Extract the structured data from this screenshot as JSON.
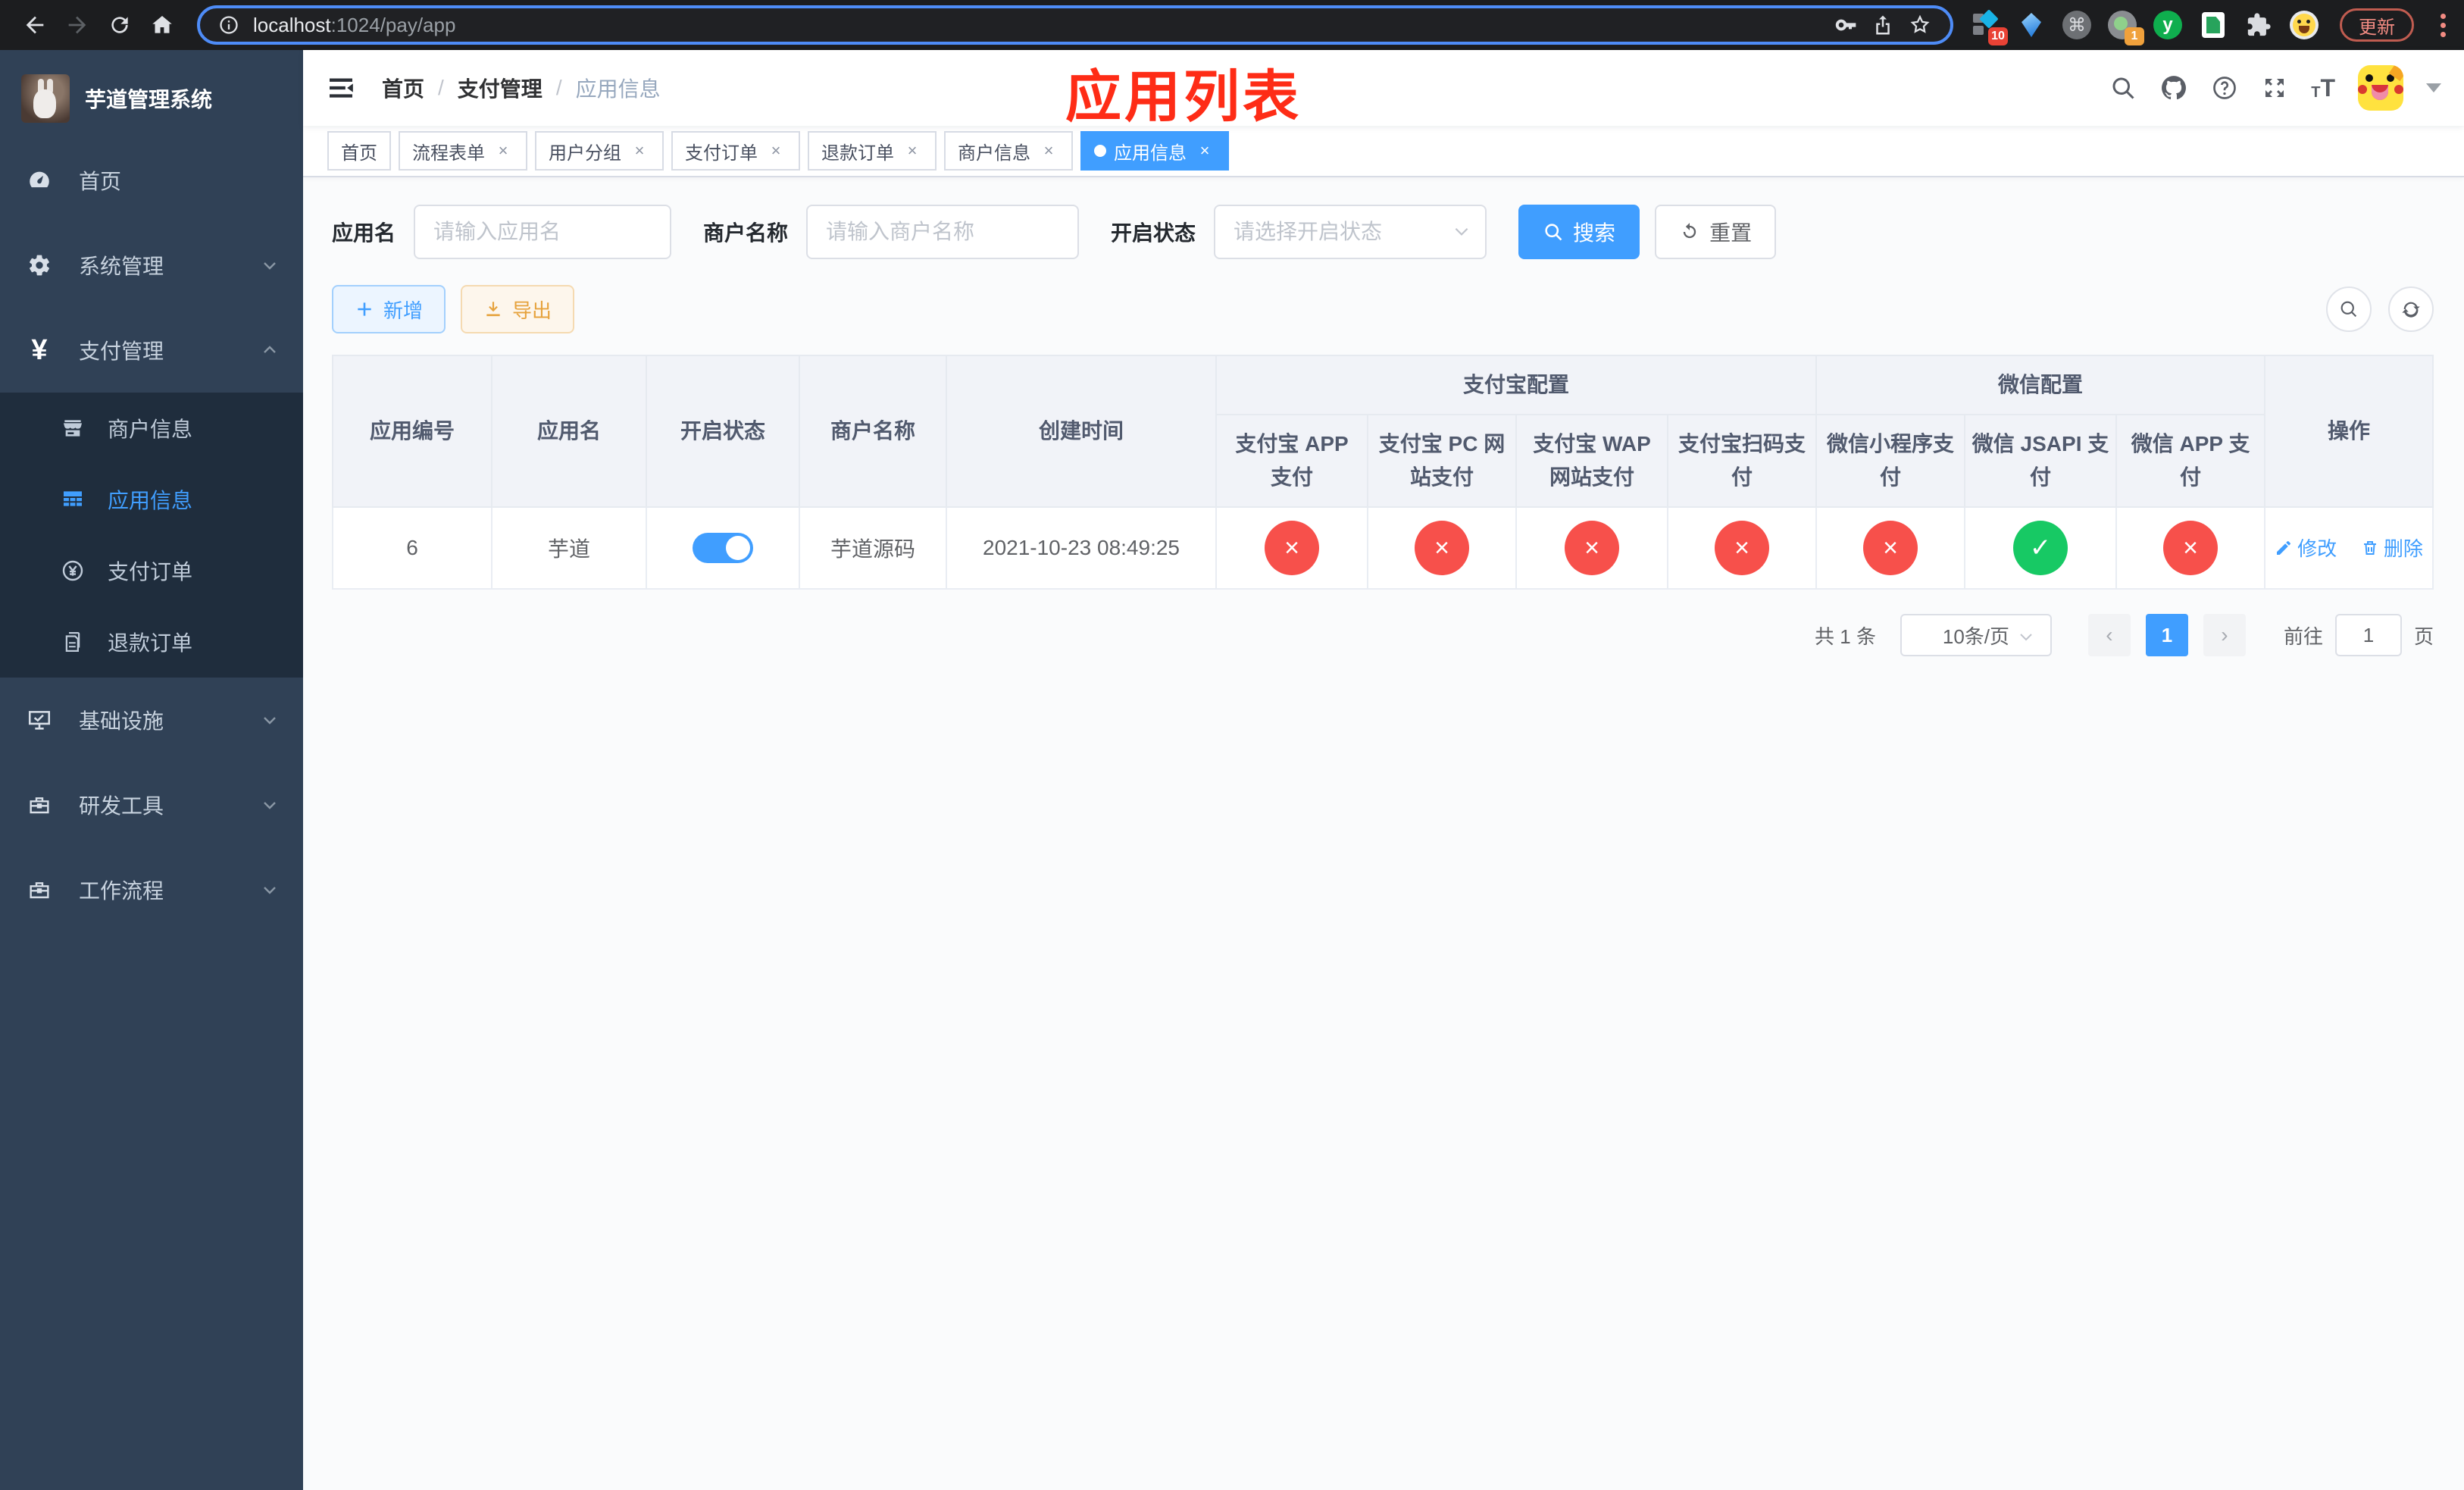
{
  "browser": {
    "url_host": "localhost",
    "url_rest": ":1024/pay/app",
    "ext_badge_kit": "10",
    "ext_badge_cam": "1",
    "ext_y_letter": "y",
    "command_glyph": "⌘",
    "update_label": "更新"
  },
  "sidebar": {
    "title": "芋道管理系统",
    "items": [
      {
        "label": "首页"
      },
      {
        "label": "系统管理"
      },
      {
        "label": "支付管理"
      },
      {
        "label": "基础设施"
      },
      {
        "label": "研发工具"
      },
      {
        "label": "工作流程"
      }
    ],
    "submenu": [
      {
        "label": "商户信息"
      },
      {
        "label": "应用信息"
      },
      {
        "label": "支付订单"
      },
      {
        "label": "退款订单"
      }
    ],
    "yen_glyph": "¥"
  },
  "header": {
    "breadcrumb": [
      {
        "label": "首页"
      },
      {
        "label": "支付管理"
      },
      {
        "label": "应用信息"
      }
    ],
    "separator": "/",
    "annotation": "应用列表",
    "font_t_small": "T",
    "font_t_big": "T"
  },
  "tabs": [
    {
      "label": "首页"
    },
    {
      "label": "流程表单"
    },
    {
      "label": "用户分组"
    },
    {
      "label": "支付订单"
    },
    {
      "label": "退款订单"
    },
    {
      "label": "商户信息"
    },
    {
      "label": "应用信息"
    }
  ],
  "ui": {
    "close_glyph": "×",
    "help_glyph": "?"
  },
  "filter": {
    "name_label": "应用名",
    "name_placeholder": "请输入应用名",
    "merchant_label": "商户名称",
    "merchant_placeholder": "请输入商户名称",
    "status_label": "开启状态",
    "status_placeholder": "请选择开启状态",
    "search_label": "搜索",
    "reset_label": "重置"
  },
  "toolbar": {
    "add_label": "新增",
    "export_label": "导出"
  },
  "table": {
    "groups": {
      "alipay": "支付宝配置",
      "wechat": "微信配置"
    },
    "headers": {
      "id": "应用编号",
      "name": "应用名",
      "status": "开启状态",
      "merchant": "商户名称",
      "created": "创建时间",
      "alipay_app": "支付宝 APP 支付",
      "alipay_pc": "支付宝 PC 网站支付",
      "alipay_wap": "支付宝 WAP 网站支付",
      "alipay_qr": "支付宝扫码支付",
      "wx_mini": "微信小程序支付",
      "wx_jsapi": "微信 JSAPI 支付",
      "wx_app": "微信 APP 支付",
      "actions": "操作"
    },
    "row": {
      "id": "6",
      "name": "芋道",
      "merchant": "芋道源码",
      "created": "2021-10-23 08:49:25",
      "statuses": [
        "fail",
        "fail",
        "fail",
        "fail",
        "fail",
        "ok",
        "fail"
      ],
      "edit_label": "修改",
      "delete_label": "删除"
    },
    "status_glyphs": {
      "ok": "✓",
      "fail": "×"
    }
  },
  "pagination": {
    "total_text": "共 1 条",
    "page_size": "10条/页",
    "prev_glyph": "‹",
    "next_glyph": "›",
    "current_page": "1",
    "goto_label": "前往",
    "goto_value": "1",
    "page_suffix": "页"
  },
  "colors": {
    "accent": "#409eff",
    "danger": "#f7504b",
    "success": "#17c964",
    "annotation": "#fe2c16"
  }
}
